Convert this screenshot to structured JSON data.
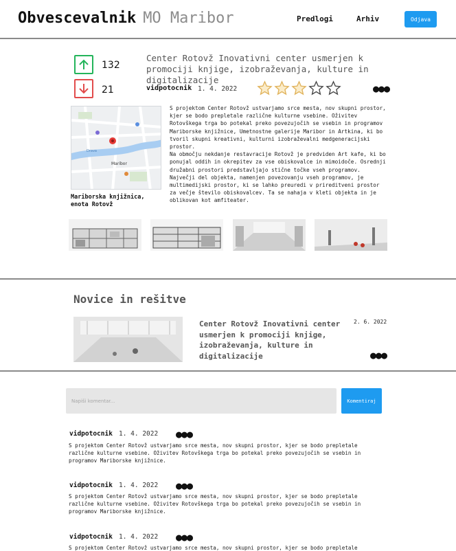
{
  "header": {
    "logo": "Obvescevalnik",
    "logo_sub": "MO Maribor",
    "nav": {
      "predlogi": "Predlogi",
      "arhiv": "Arhiv"
    },
    "logout": "Odjava"
  },
  "post": {
    "upvotes": "132",
    "downvotes": "21",
    "title": "Center Rotovž Inovativni center usmerjen k promociji knjige, izobraževanja, kulture in digitalizacije",
    "author": "vidpotocnik",
    "date": "1. 4. 2022",
    "rating": 3,
    "rating_max": 5,
    "map_caption": "Mariborska knjižnica, enota Rotovž",
    "body": "S projektom Center Rotovž ustvarjamo srce mesta, nov skupni prostor, kjer se bodo prepletale različne kulturne vsebine. Oživitev Rotovškega trga bo potekal preko povezujočih se vsebin in programov Mariborske knjižnice, Umetnostne galerije Maribor in Artkina, ki bo tvoril skupni kreativni, kulturni izobraževalni medgeneracijski prostor.\nNa območju nekdanje restavracije Rotovž je predviden Art kafe, ki bo ponujal oddih in okrepitev za vse obiskovalce in mimoidoče. Osrednji družabni prostori predstavljajo stične točke vseh programov. Največji del objekta, namenjen povezovanju vseh programov, je multimedijski prostor, ki se lahko preuredi v prireditveni prostor za večje število obiskovalcev. Ta se nahaja v kleti objekta in je oblikovan kot amfiteater.",
    "map_labels": {
      "city": "Maribor",
      "river": "Drava"
    }
  },
  "news": {
    "heading": "Novice in rešitve",
    "items": [
      {
        "title": "Center Rotovž Inovativni center usmerjen k promociji knjige, izobraževanja, kulture in digitalizacije",
        "date": "2. 6. 2022"
      }
    ]
  },
  "comments_section": {
    "placeholder": "Napiši komentar...",
    "submit": "Komentiraj",
    "comments": [
      {
        "author": "vidpotocnik",
        "date": "1. 4. 2022",
        "text": "S projektom Center Rotovž ustvarjamo srce mesta, nov skupni prostor, kjer se bodo prepletale različne kulturne vsebine. Oživitev Rotovškega trga bo potekal preko povezujočih se vsebin in programov Mariborske knjižnice."
      },
      {
        "author": "vidpotocnik",
        "date": "1. 4. 2022",
        "text": "S projektom Center Rotovž ustvarjamo srce mesta, nov skupni prostor, kjer se bodo prepletale različne kulturne vsebine. Oživitev Rotovškega trga bo potekal preko povezujočih se vsebin in programov Mariborske knjižnice."
      },
      {
        "author": "vidpotocnik",
        "date": "1. 4. 2022",
        "text": "S projektom Center Rotovž ustvarjamo srce mesta, nov skupni prostor, kjer se bodo prepletale različne kulturne vsebine. Oživitev Rotovškega trga bo potekal preko povezujočih se vsebin in programov Mariborske knjižnice."
      }
    ]
  },
  "colors": {
    "accent": "#1e9bf0",
    "upvote": "#23b45a",
    "downvote": "#e24b4b",
    "star": "#e0b25a",
    "star_empty": "#444444"
  },
  "icons": {
    "upvote": "arrow-up-icon",
    "downvote": "arrow-down-icon",
    "more": "more-dots-icon",
    "star": "star-icon"
  }
}
